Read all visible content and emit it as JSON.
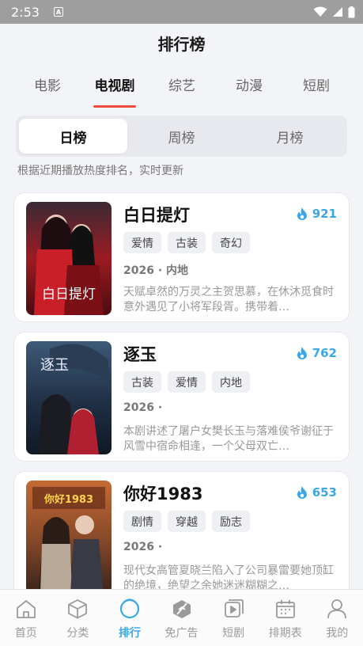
{
  "status": {
    "time": "2:53",
    "notif_letter": "A"
  },
  "header": {
    "title": "排行榜"
  },
  "tabs": [
    {
      "label": "电影"
    },
    {
      "label": "电视剧"
    },
    {
      "label": "综艺"
    },
    {
      "label": "动漫"
    },
    {
      "label": "短剧"
    }
  ],
  "segment": [
    "日榜",
    "周榜",
    "月榜"
  ],
  "subtitle": "根据近期播放热度排名，实时更新",
  "items": [
    {
      "title": "白日提灯",
      "heat": "921",
      "tags": [
        "爱情",
        "古装",
        "奇幻"
      ],
      "meta": "2026 · 内地",
      "desc": "天赋卓然的万灵之主贺思慕，在休沐觅食时意外遇见了小将军段胥。携带着…",
      "poster_text": "白日提灯"
    },
    {
      "title": "逐玉",
      "heat": "762",
      "tags": [
        "古装",
        "爱情",
        "内地"
      ],
      "meta": "2026 ·",
      "desc": "本剧讲述了屠户女樊长玉与落难侯爷谢征于风雪中宿命相逢，一个父母双亡…",
      "poster_text": "逐玉"
    },
    {
      "title": "你好1983",
      "heat": "653",
      "tags": [
        "剧情",
        "穿越",
        "励志"
      ],
      "meta": "2026 ·",
      "desc": "现代女高管夏晓兰陷入了公司暴雷要她顶缸的绝境，绝望之余她迷迷糊糊之…",
      "poster_text": "你好1983"
    }
  ],
  "nav": [
    {
      "label": "首页",
      "icon": "home-icon"
    },
    {
      "label": "分类",
      "icon": "cube-icon"
    },
    {
      "label": "排行",
      "icon": "ranking-icon"
    },
    {
      "label": "免广告",
      "icon": "no-ads-icon"
    },
    {
      "label": "短剧",
      "icon": "short-drama-icon"
    },
    {
      "label": "排期表",
      "icon": "calendar-icon"
    },
    {
      "label": "我的",
      "icon": "profile-icon"
    }
  ],
  "colors": {
    "accent": "#3ba7e6",
    "tab_underline": "#f04a3a"
  }
}
